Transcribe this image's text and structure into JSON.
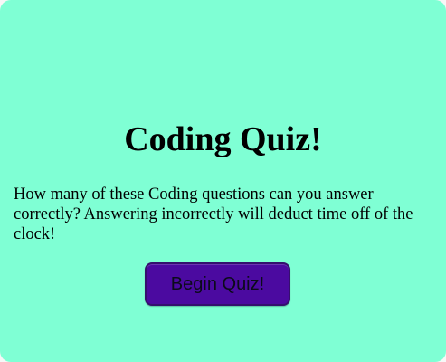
{
  "quiz": {
    "title": "Coding Quiz!",
    "intro": "How many of these Coding questions can you answer correctly? Answering incorrectly will deduct time off of the clock!",
    "start_button_label": "Begin Quiz!"
  },
  "colors": {
    "page_background": "#7fffd4",
    "button_background": "#4b0aa0",
    "text": "#000000"
  }
}
